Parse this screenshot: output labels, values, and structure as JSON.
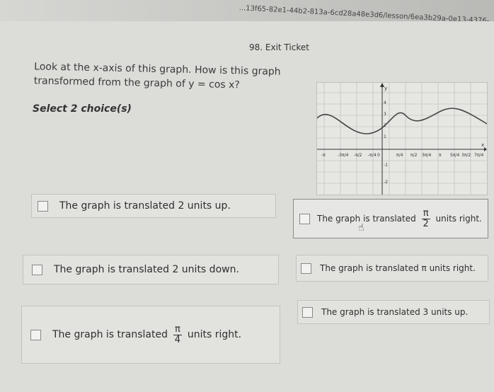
{
  "browser": {
    "url_fragment": "...13f65-82e1-44b2-813a-6cd28a48e3d6/lesson/6ea3b29a-0e13-4376-..."
  },
  "header": {
    "title": "98. Exit Ticket"
  },
  "question": {
    "text": "Look at the x-axis of this graph. How is this graph transformed from the graph of y = cos x?"
  },
  "instruction": "Select 2 choice(s)",
  "graph": {
    "y_axis_label": "y",
    "x_axis_label": "x",
    "y_ticks": [
      "4",
      "3",
      "2",
      "1",
      "-1",
      "-2"
    ],
    "x_ticks_left": [
      "-π",
      "-3π/4",
      "-π/2",
      "-π/4",
      "0"
    ],
    "x_ticks_right": [
      "π/4",
      "π/2",
      "3π/4",
      "π",
      "5π/4",
      "3π/2",
      "7π/4"
    ]
  },
  "choices": [
    {
      "text": "The graph is translated 2 units up."
    },
    {
      "text_before": "The graph is translated",
      "frac_num": "π",
      "frac_den": "2",
      "text_after": "units right."
    },
    {
      "text": "The graph is translated 2 units down."
    },
    {
      "text": "The graph is translated π units right."
    },
    {
      "text_before": "The graph is translated",
      "frac_num": "π",
      "frac_den": "4",
      "text_after": "units right."
    },
    {
      "text": "The graph is translated 3 units up."
    }
  ]
}
